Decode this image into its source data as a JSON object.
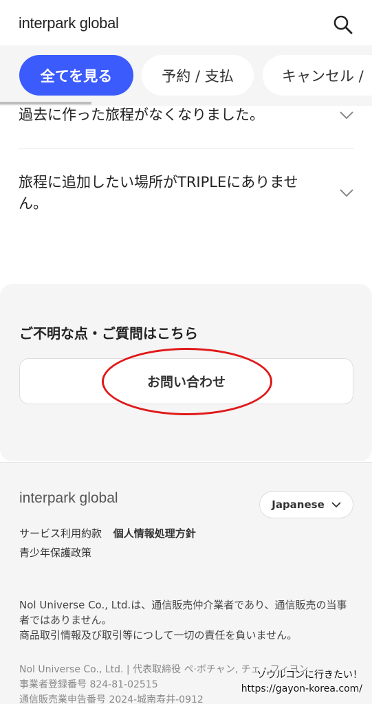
{
  "header": {
    "logo": "interpark global",
    "search_icon": "search-icon"
  },
  "tabs": [
    {
      "label": "全てを見る",
      "active": true
    },
    {
      "label": "予約 / 支払",
      "active": false
    },
    {
      "label": "キャンセル /",
      "active": false
    }
  ],
  "faq": [
    {
      "question": "過去に作った旅程がなくなりました。"
    },
    {
      "question": "旅程に追加したい場所がTRIPLEにありません。"
    }
  ],
  "inquiry": {
    "title": "ご不明な点・ご質問はこちら",
    "button_label": "お問い合わせ"
  },
  "footer": {
    "logo": "interpark global",
    "language": "Japanese",
    "terms_link": "サービス利用約款",
    "privacy_link": "個人情報処理方針",
    "youth_link": "青少年保護政策",
    "disclaimer_1": "Nol Universe Co., Ltd.は、通信販売仲介業者であり、通信販売の当事者ではありません。",
    "disclaimer_2": "商品取引情報及び取引等につして一切の責任を負いません。",
    "company_1": "Nol Universe Co., Ltd. | 代表取締役 ペ·ボチャン, チェ・フィヨン",
    "company_2": "事業者登録番号 824-81-02515",
    "company_3": "通信販売業申告番号 2024-城南寿井-0912"
  },
  "watermark": {
    "line1": "ソウルコンに行きたい！",
    "line2": "https://gayon-korea.com/"
  },
  "colors": {
    "accent": "#3b5bfd",
    "annotation": "#e01919",
    "panel_bg": "#f5f5f5"
  }
}
